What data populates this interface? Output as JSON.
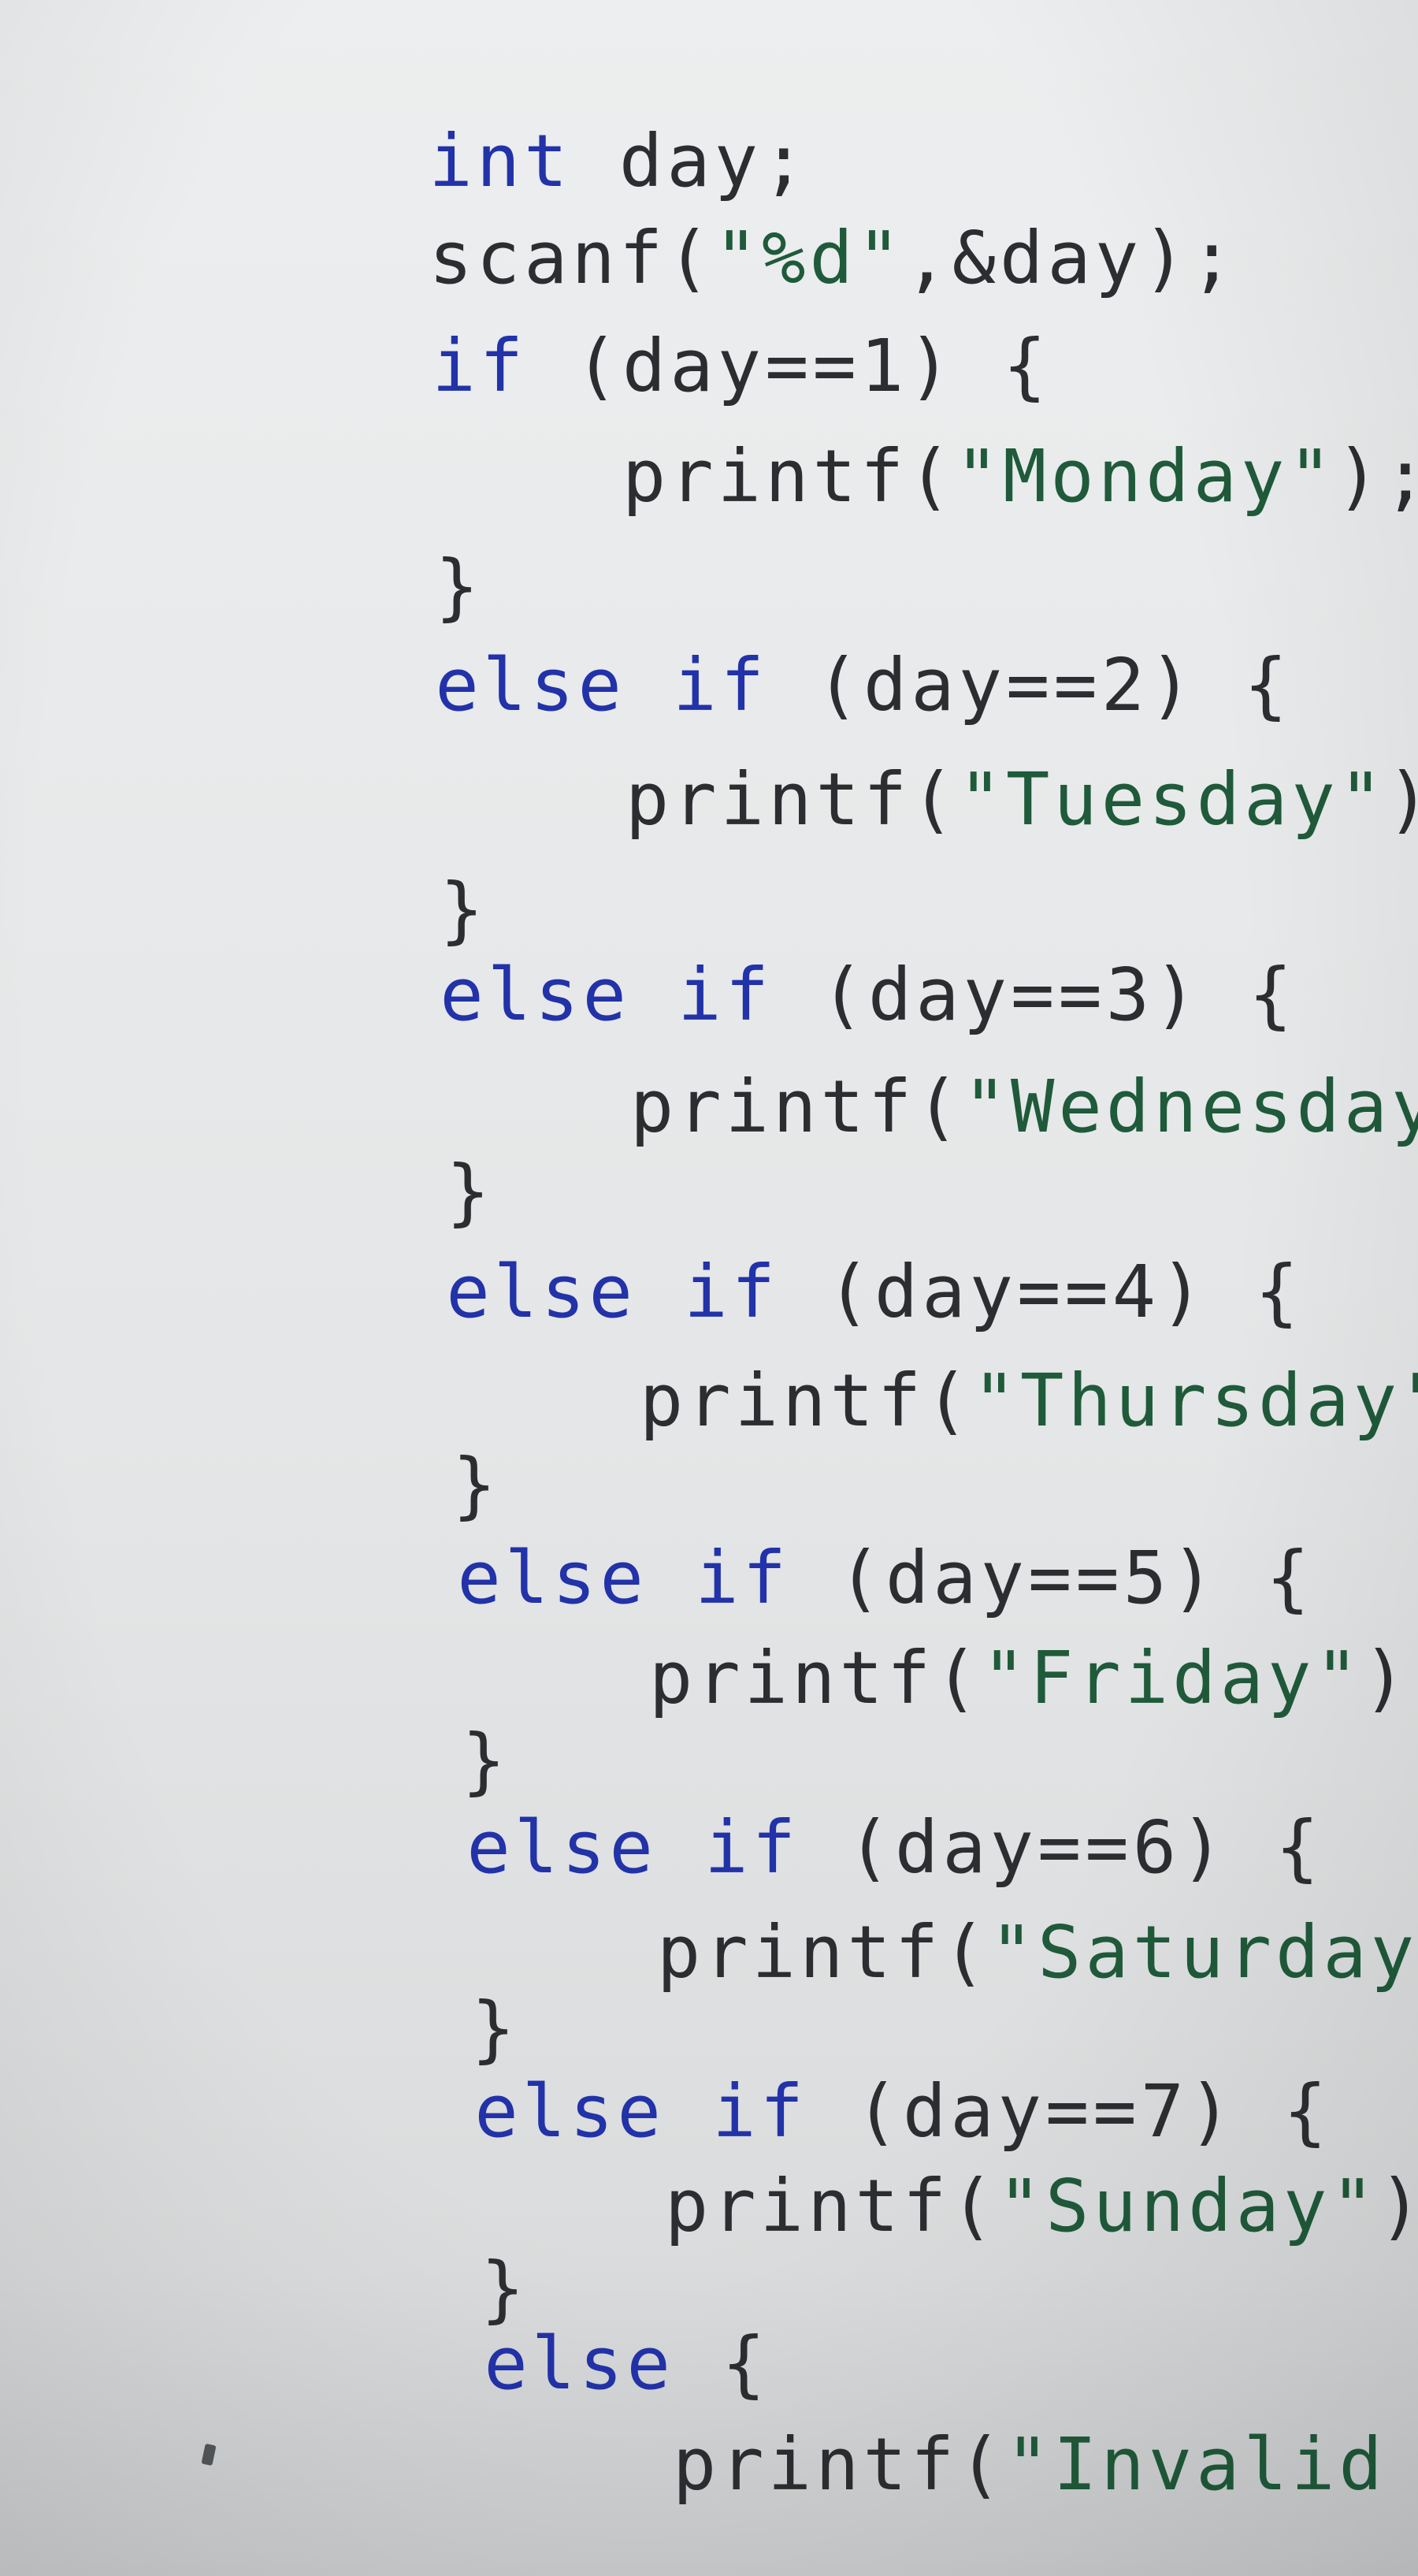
{
  "code": {
    "lines": [
      {
        "tokens": [
          {
            "t": "int",
            "k": "kw"
          },
          {
            "t": " day;",
            "k": "plain"
          }
        ]
      },
      {
        "tokens": [
          {
            "t": "scanf(",
            "k": "plain"
          },
          {
            "t": "\"%d\"",
            "k": "str"
          },
          {
            "t": ",&day);",
            "k": "plain"
          }
        ]
      },
      {
        "tokens": [
          {
            "t": "if",
            "k": "kw"
          },
          {
            "t": " (day==1) {",
            "k": "plain"
          }
        ]
      },
      {
        "tokens": [
          {
            "t": "    printf(",
            "k": "plain"
          },
          {
            "t": "\"Monday\"",
            "k": "str"
          },
          {
            "t": ");",
            "k": "plain"
          }
        ]
      },
      {
        "tokens": [
          {
            "t": "}",
            "k": "plain"
          }
        ]
      },
      {
        "tokens": [
          {
            "t": "else if",
            "k": "kw"
          },
          {
            "t": " (day==2) {",
            "k": "plain"
          }
        ]
      },
      {
        "tokens": [
          {
            "t": "    printf(",
            "k": "plain"
          },
          {
            "t": "\"Tuesday\"",
            "k": "str"
          },
          {
            "t": ");",
            "k": "plain"
          }
        ]
      },
      {
        "tokens": [
          {
            "t": "}",
            "k": "plain"
          }
        ]
      },
      {
        "tokens": [
          {
            "t": "else if",
            "k": "kw"
          },
          {
            "t": " (day==3) {",
            "k": "plain"
          }
        ]
      },
      {
        "tokens": [
          {
            "t": "    printf(",
            "k": "plain"
          },
          {
            "t": "\"Wednesday\"",
            "k": "str"
          },
          {
            "t": ");",
            "k": "plain"
          }
        ]
      },
      {
        "tokens": [
          {
            "t": "}",
            "k": "plain"
          }
        ]
      },
      {
        "tokens": [
          {
            "t": "else if",
            "k": "kw"
          },
          {
            "t": " (day==4) {",
            "k": "plain"
          }
        ]
      },
      {
        "tokens": [
          {
            "t": "    printf(",
            "k": "plain"
          },
          {
            "t": "\"Thursday\"",
            "k": "str"
          },
          {
            "t": ");",
            "k": "plain"
          }
        ]
      },
      {
        "tokens": [
          {
            "t": "}",
            "k": "plain"
          }
        ]
      },
      {
        "tokens": [
          {
            "t": "else if",
            "k": "kw"
          },
          {
            "t": " (day==5) {",
            "k": "plain"
          }
        ]
      },
      {
        "tokens": [
          {
            "t": "    printf(",
            "k": "plain"
          },
          {
            "t": "\"Friday\"",
            "k": "str"
          },
          {
            "t": ");",
            "k": "plain"
          }
        ]
      },
      {
        "tokens": [
          {
            "t": "}",
            "k": "plain"
          }
        ]
      },
      {
        "tokens": [
          {
            "t": "else if",
            "k": "kw"
          },
          {
            "t": " (day==6) {",
            "k": "plain"
          }
        ]
      },
      {
        "tokens": [
          {
            "t": "    printf(",
            "k": "plain"
          },
          {
            "t": "\"Saturday\"",
            "k": "str"
          },
          {
            "t": ");",
            "k": "plain"
          }
        ]
      },
      {
        "tokens": [
          {
            "t": "}",
            "k": "plain"
          }
        ]
      },
      {
        "tokens": [
          {
            "t": "else if",
            "k": "kw"
          },
          {
            "t": " (day==7) {",
            "k": "plain"
          }
        ]
      },
      {
        "tokens": [
          {
            "t": "    printf(",
            "k": "plain"
          },
          {
            "t": "\"Sunday\"",
            "k": "str"
          },
          {
            "t": ");",
            "k": "plain"
          }
        ]
      },
      {
        "tokens": [
          {
            "t": "}",
            "k": "plain"
          }
        ]
      },
      {
        "tokens": [
          {
            "t": "else",
            "k": "kw"
          },
          {
            "t": " {",
            "k": "plain"
          }
        ]
      },
      {
        "tokens": [
          {
            "t": "    printf(",
            "k": "plain"
          },
          {
            "t": "\"Invalid Input\"",
            "k": "str"
          },
          {
            "t": ");",
            "k": "plain"
          }
        ]
      }
    ]
  },
  "colors": {
    "background": "#e6e7e8",
    "keyword": "#2232a8",
    "string": "#1f5a3a",
    "text": "#2b2d30"
  }
}
